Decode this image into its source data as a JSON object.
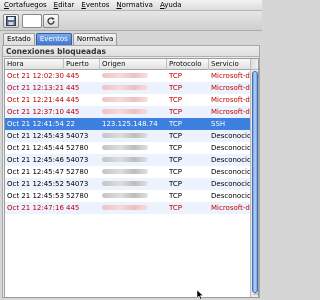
{
  "menu": [
    {
      "label": "Cortafuegos"
    },
    {
      "label": "Editar"
    },
    {
      "label": "Eventos"
    },
    {
      "label": "Normativa"
    },
    {
      "label": "Ayuda"
    }
  ],
  "toolbar": {
    "save_icon": "save-icon",
    "refresh_icon": "refresh-icon"
  },
  "tabs": [
    {
      "label": "Estado",
      "active": false
    },
    {
      "label": "Eventos",
      "active": true
    },
    {
      "label": "Normativa",
      "active": false
    }
  ],
  "panel": {
    "title": "Conexiones bloqueadas"
  },
  "table": {
    "headers": [
      "Hora",
      "Puerto",
      "Origen",
      "Protocolo",
      "Servicio"
    ],
    "rows": [
      {
        "time": "Oct 21 12:02:30",
        "port": "445",
        "origin": "",
        "protocol": "TCP",
        "service": "Microsoft-ds",
        "style": "red"
      },
      {
        "time": "Oct 21 12:13:21",
        "port": "445",
        "origin": "",
        "protocol": "TCP",
        "service": "Microsoft-ds",
        "style": "red"
      },
      {
        "time": "Oct 21 12:21:44",
        "port": "445",
        "origin": "",
        "protocol": "TCP",
        "service": "Microsoft-ds",
        "style": "red"
      },
      {
        "time": "Oct 21 12:37:10",
        "port": "445",
        "origin": "",
        "protocol": "TCP",
        "service": "Microsoft-ds",
        "style": "red"
      },
      {
        "time": "Oct 21 12:41:54",
        "port": "22",
        "origin": "123.125.148.74",
        "protocol": "TCP",
        "service": "SSH",
        "style": "sel"
      },
      {
        "time": "Oct 21 12:45:43",
        "port": "54073",
        "origin": "",
        "protocol": "TCP",
        "service": "Desconocido",
        "style": "gray"
      },
      {
        "time": "Oct 21 12:45:44",
        "port": "52780",
        "origin": "",
        "protocol": "TCP",
        "service": "Desconocido",
        "style": "gray"
      },
      {
        "time": "Oct 21 12:45:46",
        "port": "54073",
        "origin": "",
        "protocol": "TCP",
        "service": "Desconocido",
        "style": "gray"
      },
      {
        "time": "Oct 21 12:45:47",
        "port": "52780",
        "origin": "",
        "protocol": "TCP",
        "service": "Desconocido",
        "style": "gray"
      },
      {
        "time": "Oct 21 12:45:52",
        "port": "54073",
        "origin": "",
        "protocol": "TCP",
        "service": "Desconocido",
        "style": "gray"
      },
      {
        "time": "Oct 21 12:45:53",
        "port": "52780",
        "origin": "",
        "protocol": "TCP",
        "service": "Desconocido",
        "style": "gray"
      },
      {
        "time": "Oct 21 12:47:16",
        "port": "445",
        "origin": "",
        "protocol": "TCP",
        "service": "Microsoft-ds",
        "style": "red"
      }
    ]
  },
  "colors": {
    "selection": "#3d80df",
    "alert_text": "#c00000",
    "stripe": "#edf3fe"
  }
}
